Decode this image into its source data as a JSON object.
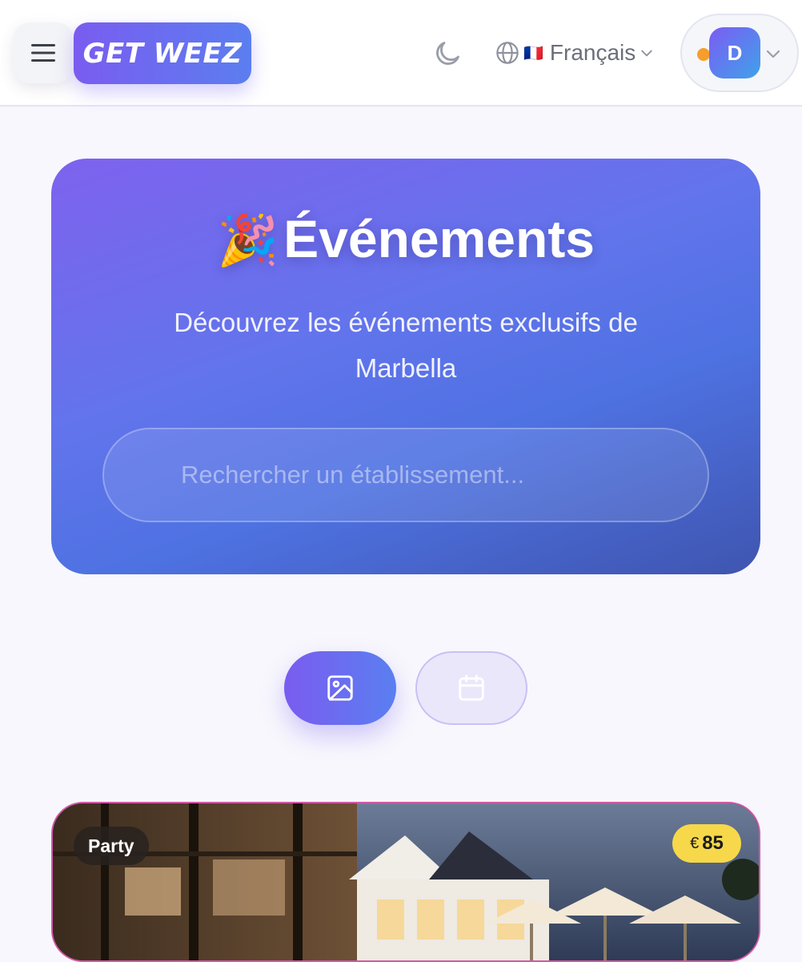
{
  "header": {
    "logo_text": "GET WEEZ",
    "language": {
      "flag": "🇫🇷",
      "label": "Français"
    },
    "user": {
      "initial": "D"
    }
  },
  "hero": {
    "emoji": "🎉",
    "title": "Événements",
    "subtitle": "Découvrez les événements exclusifs de Marbella",
    "search_placeholder": "Rechercher un établissement..."
  },
  "view_toggle": {
    "options": [
      {
        "icon": "image-icon",
        "active": true
      },
      {
        "icon": "calendar-icon",
        "active": false
      }
    ]
  },
  "events": [
    {
      "category": "Party",
      "currency": "€",
      "price": "85"
    }
  ],
  "colors": {
    "accent_start": "#7a5cf0",
    "accent_end": "#5b7ef0",
    "price_badge": "#f7d84a",
    "card_border": "#d05aa6",
    "status_dot": "#f59e2b"
  }
}
